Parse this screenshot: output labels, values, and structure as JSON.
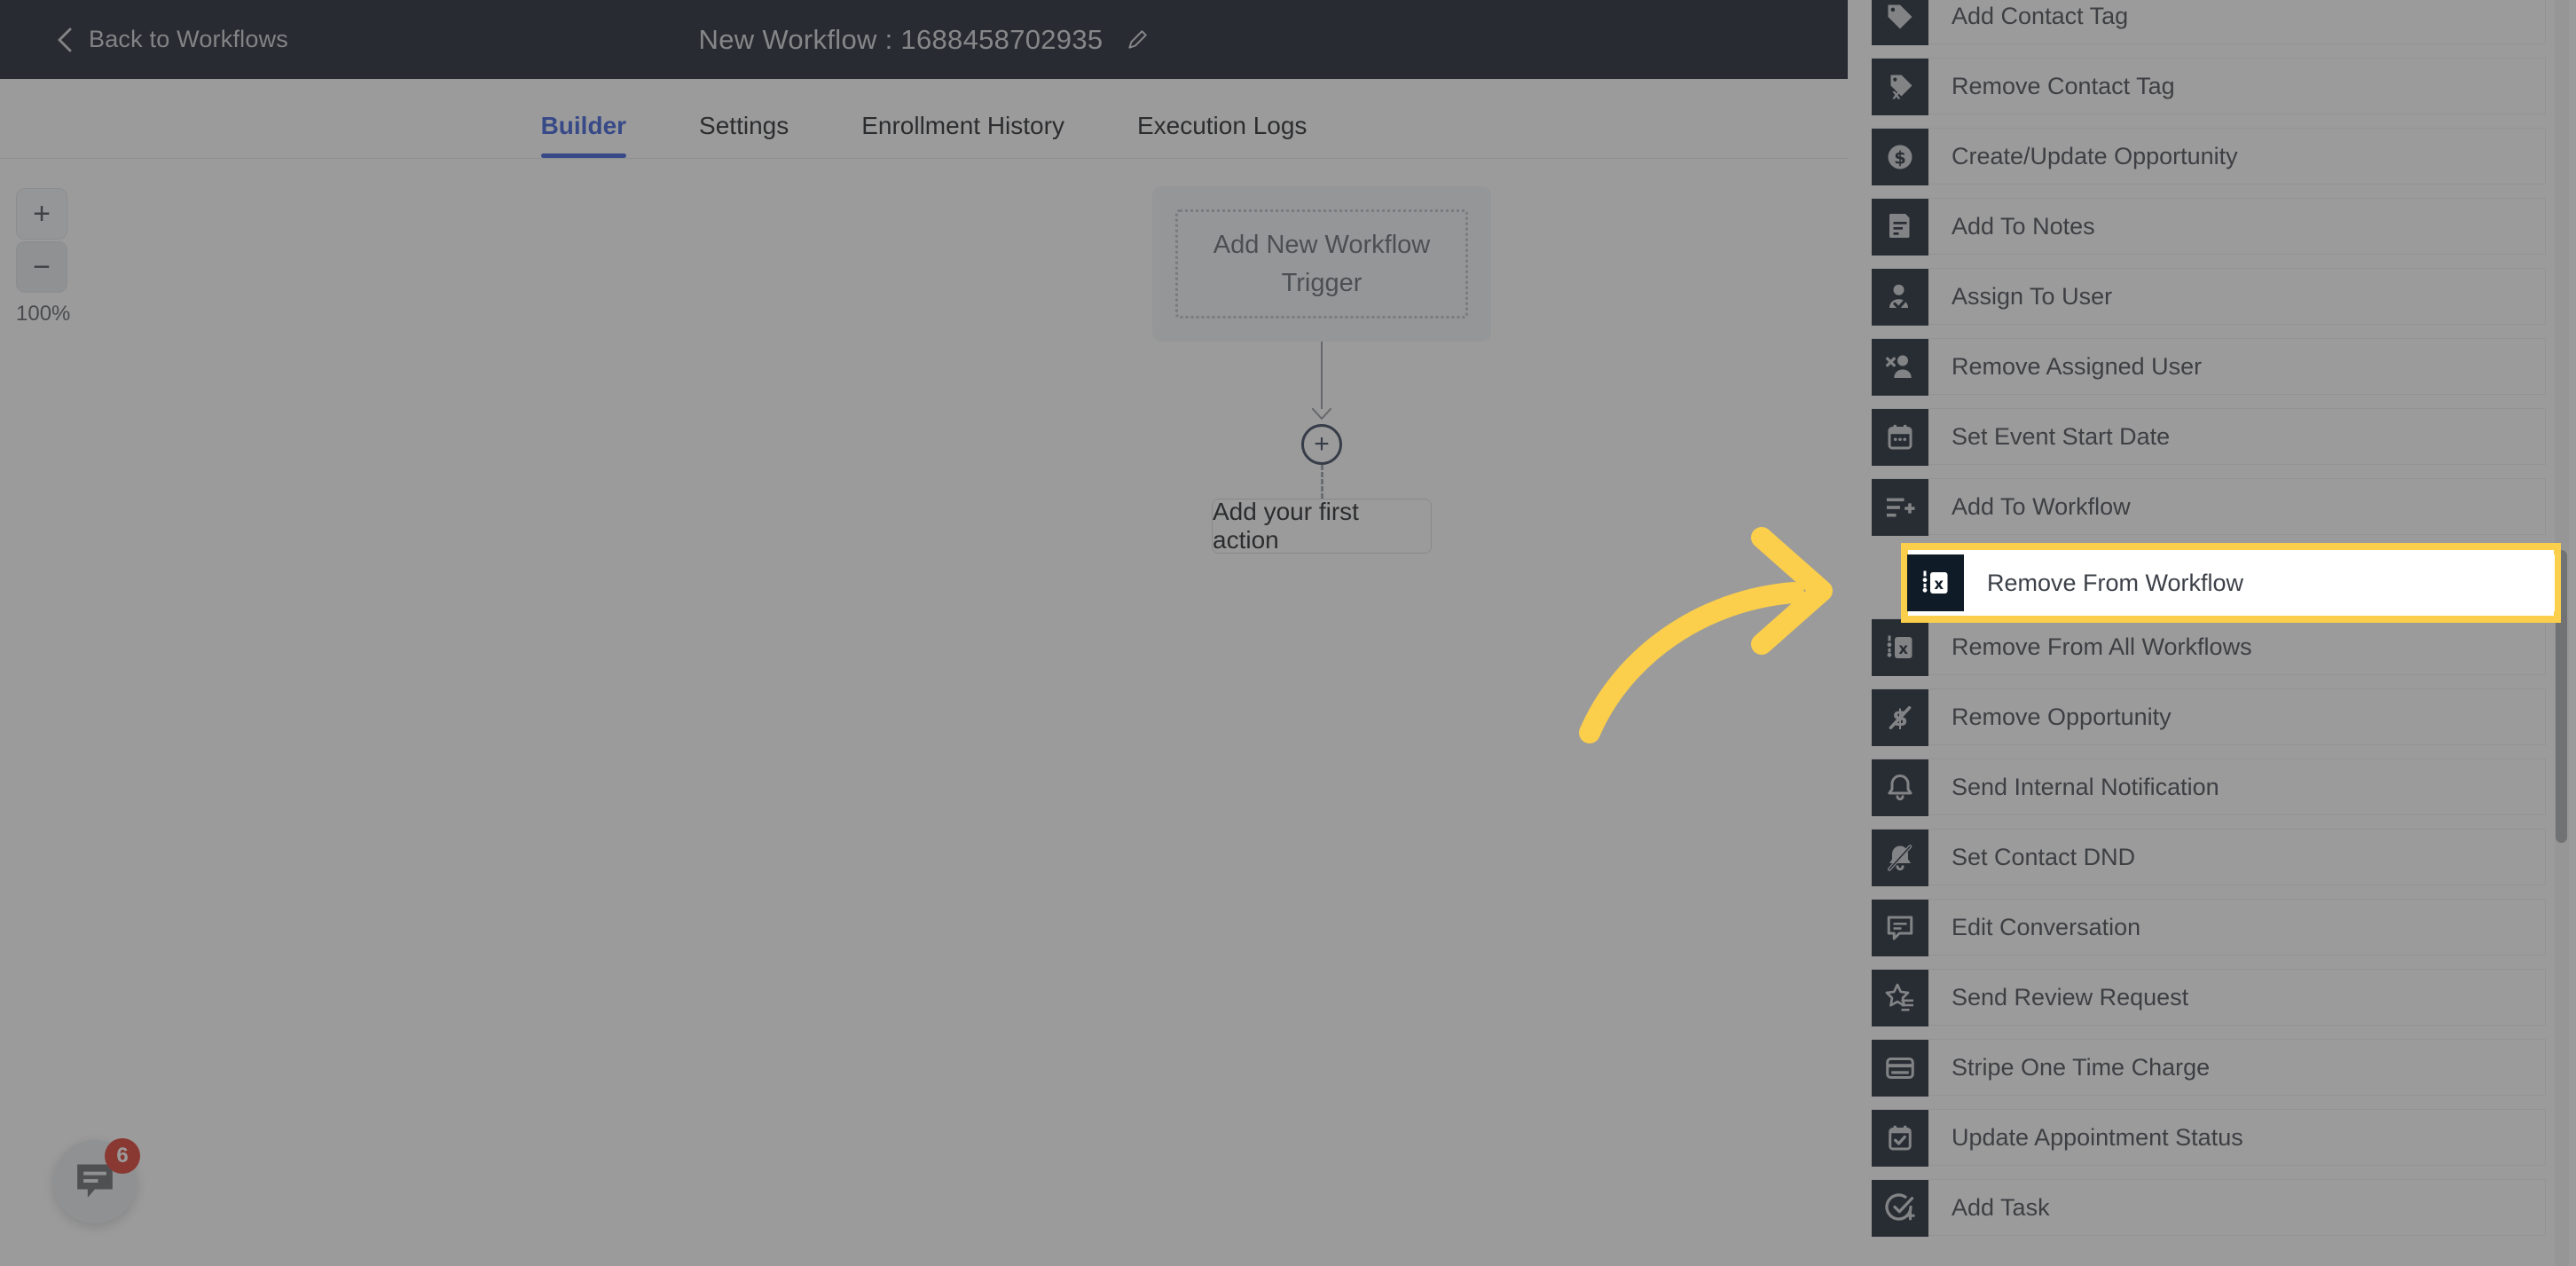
{
  "header": {
    "back_label": "Back to Workflows",
    "back_icon": "chevron-left-icon",
    "title": "New Workflow : 1688458702935",
    "edit_icon": "pencil-icon",
    "background": "#101622"
  },
  "tabs": [
    {
      "label": "Builder",
      "active": true
    },
    {
      "label": "Settings",
      "active": false
    },
    {
      "label": "Enrollment History",
      "active": false
    },
    {
      "label": "Execution Logs",
      "active": false
    }
  ],
  "tabs_accent": "#2f54d6",
  "canvas": {
    "zoom_in_label": "+",
    "zoom_out_label": "−",
    "zoom_level": "100%",
    "trigger_label": "Add New Workflow Trigger",
    "add_node_label": "+",
    "first_action_label": "Add your first action"
  },
  "chat_widget": {
    "icon": "chat-bubble-icon",
    "badge_count": "6",
    "badge_color": "#d93025"
  },
  "panel": {
    "icon_tile_color": "#101b28",
    "highlight_color": "#FBCE4B",
    "items": [
      {
        "label": "Add Contact Tag",
        "icon": "tag-icon"
      },
      {
        "label": "Remove Contact Tag",
        "icon": "tag-remove-icon"
      },
      {
        "label": "Create/Update Opportunity",
        "icon": "dollar-coin-icon"
      },
      {
        "label": "Add To Notes",
        "icon": "note-icon"
      },
      {
        "label": "Assign To User",
        "icon": "user-check-icon"
      },
      {
        "label": "Remove Assigned User",
        "icon": "user-remove-icon"
      },
      {
        "label": "Set Event Start Date",
        "icon": "calendar-icon"
      },
      {
        "label": "Add To Workflow",
        "icon": "list-plus-icon"
      },
      {
        "label": "Remove From Workflow",
        "icon": "workflow-remove-icon",
        "highlighted": true
      },
      {
        "label": "Remove From All Workflows",
        "icon": "workflow-remove-icon"
      },
      {
        "label": "Remove Opportunity",
        "icon": "dollar-slash-icon"
      },
      {
        "label": "Send Internal Notification",
        "icon": "bell-icon"
      },
      {
        "label": "Set Contact DND",
        "icon": "bell-slash-icon"
      },
      {
        "label": "Edit Conversation",
        "icon": "chat-edit-icon"
      },
      {
        "label": "Send Review Request",
        "icon": "star-list-icon"
      },
      {
        "label": "Stripe One Time Charge",
        "icon": "credit-card-icon"
      },
      {
        "label": "Update Appointment Status",
        "icon": "calendar-check-icon"
      },
      {
        "label": "Add Task",
        "icon": "task-plus-icon"
      }
    ]
  },
  "annotation": {
    "arrow_icon": "curved-arrow-right-icon",
    "arrow_color": "#FBCE4B"
  }
}
